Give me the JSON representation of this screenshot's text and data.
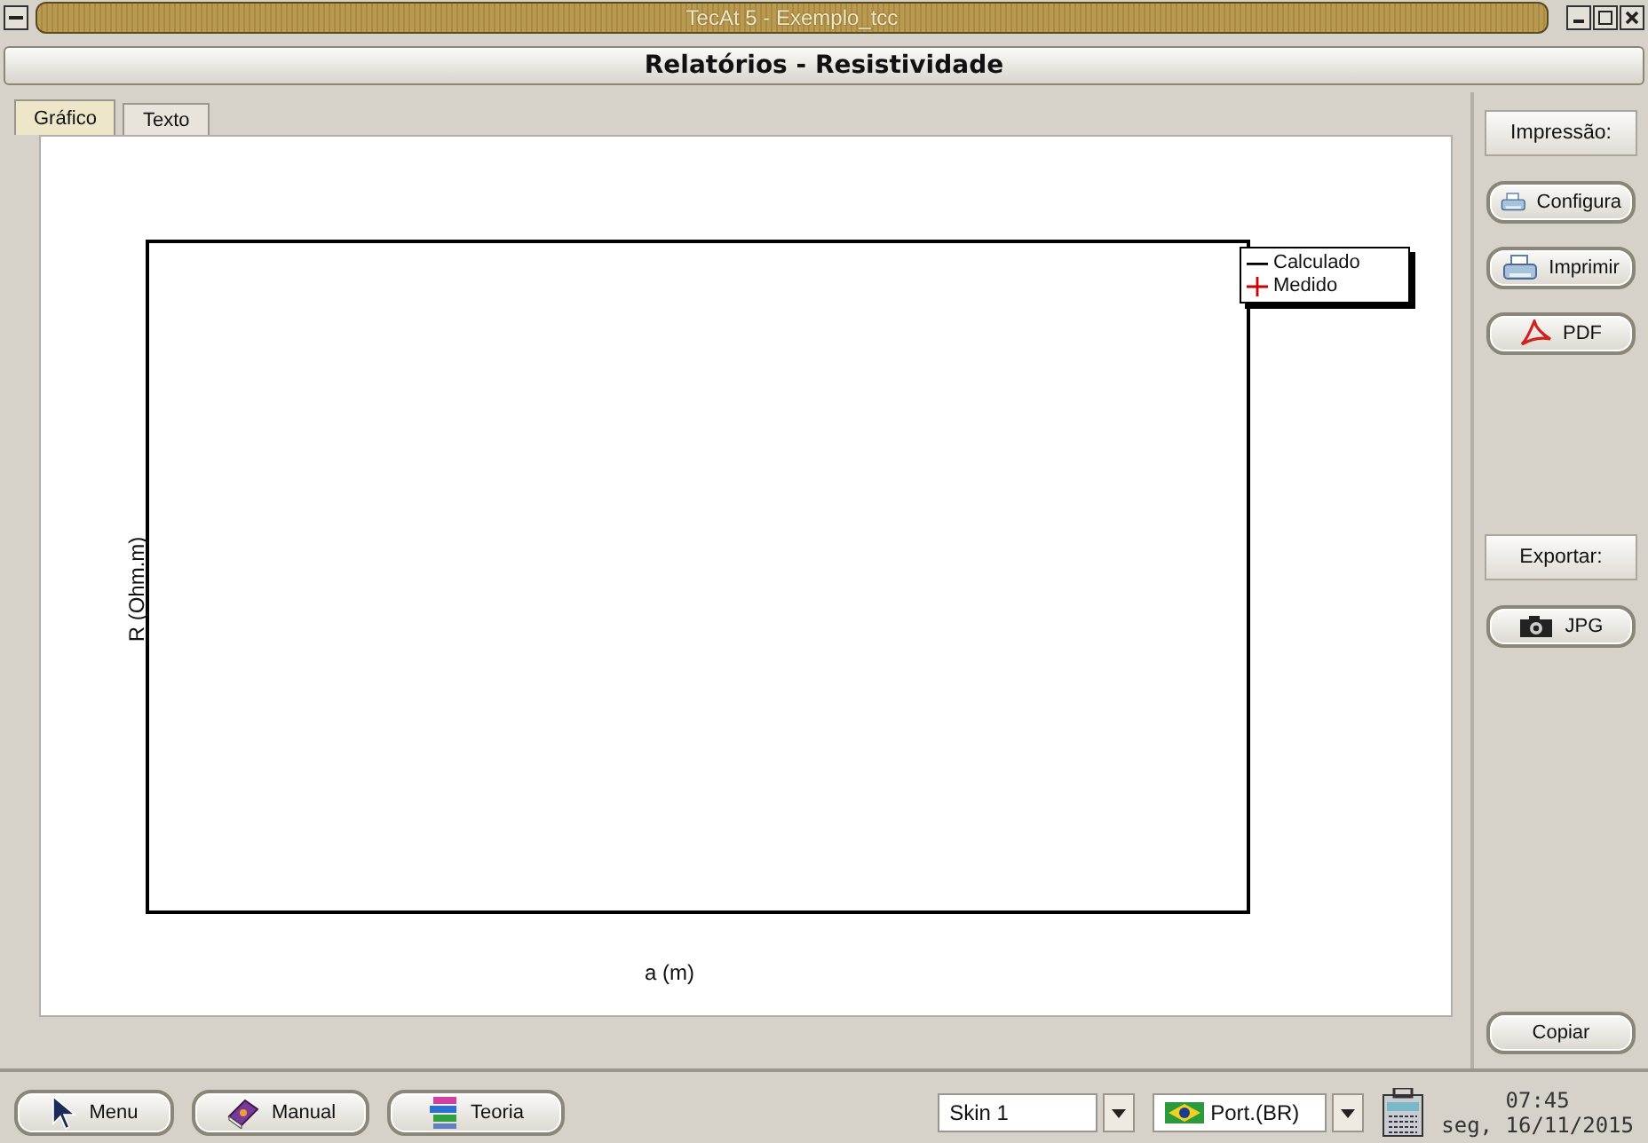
{
  "window": {
    "title": "TecAt 5 - Exemplo_tcc"
  },
  "header": {
    "title": "Relatórios - Resistividade"
  },
  "tabs": [
    {
      "label": "Gráfico",
      "selected": true
    },
    {
      "label": "Texto",
      "selected": false
    }
  ],
  "chart": {
    "ylabel": "R (Ohm.m)",
    "xlabel": "a (m)",
    "legend": [
      {
        "label": "Calculado",
        "kind": "line",
        "color": "#000000"
      },
      {
        "label": "Medido",
        "kind": "cross",
        "color": "#cc0000"
      }
    ]
  },
  "print": {
    "heading": "Impressão:",
    "buttons": [
      {
        "label": "Configura",
        "kind": "printer"
      },
      {
        "label": "Imprimir",
        "kind": "printer"
      },
      {
        "label": "PDF",
        "kind": "pdf"
      }
    ]
  },
  "export": {
    "heading": "Exportar:",
    "buttons": [
      {
        "label": "JPG",
        "kind": "camera"
      }
    ]
  },
  "copy_button": {
    "label": "Copiar"
  },
  "toolbar": {
    "buttons": [
      {
        "label": "Menu",
        "kind": "cursor"
      },
      {
        "label": "Manual",
        "kind": "book"
      },
      {
        "label": "Teoria",
        "kind": "stack"
      }
    ]
  },
  "skin": {
    "value": "Skin 1"
  },
  "language": {
    "value": "Port.(BR)"
  },
  "clock": {
    "time": "07:45",
    "date": "seg, 16/11/2015"
  }
}
